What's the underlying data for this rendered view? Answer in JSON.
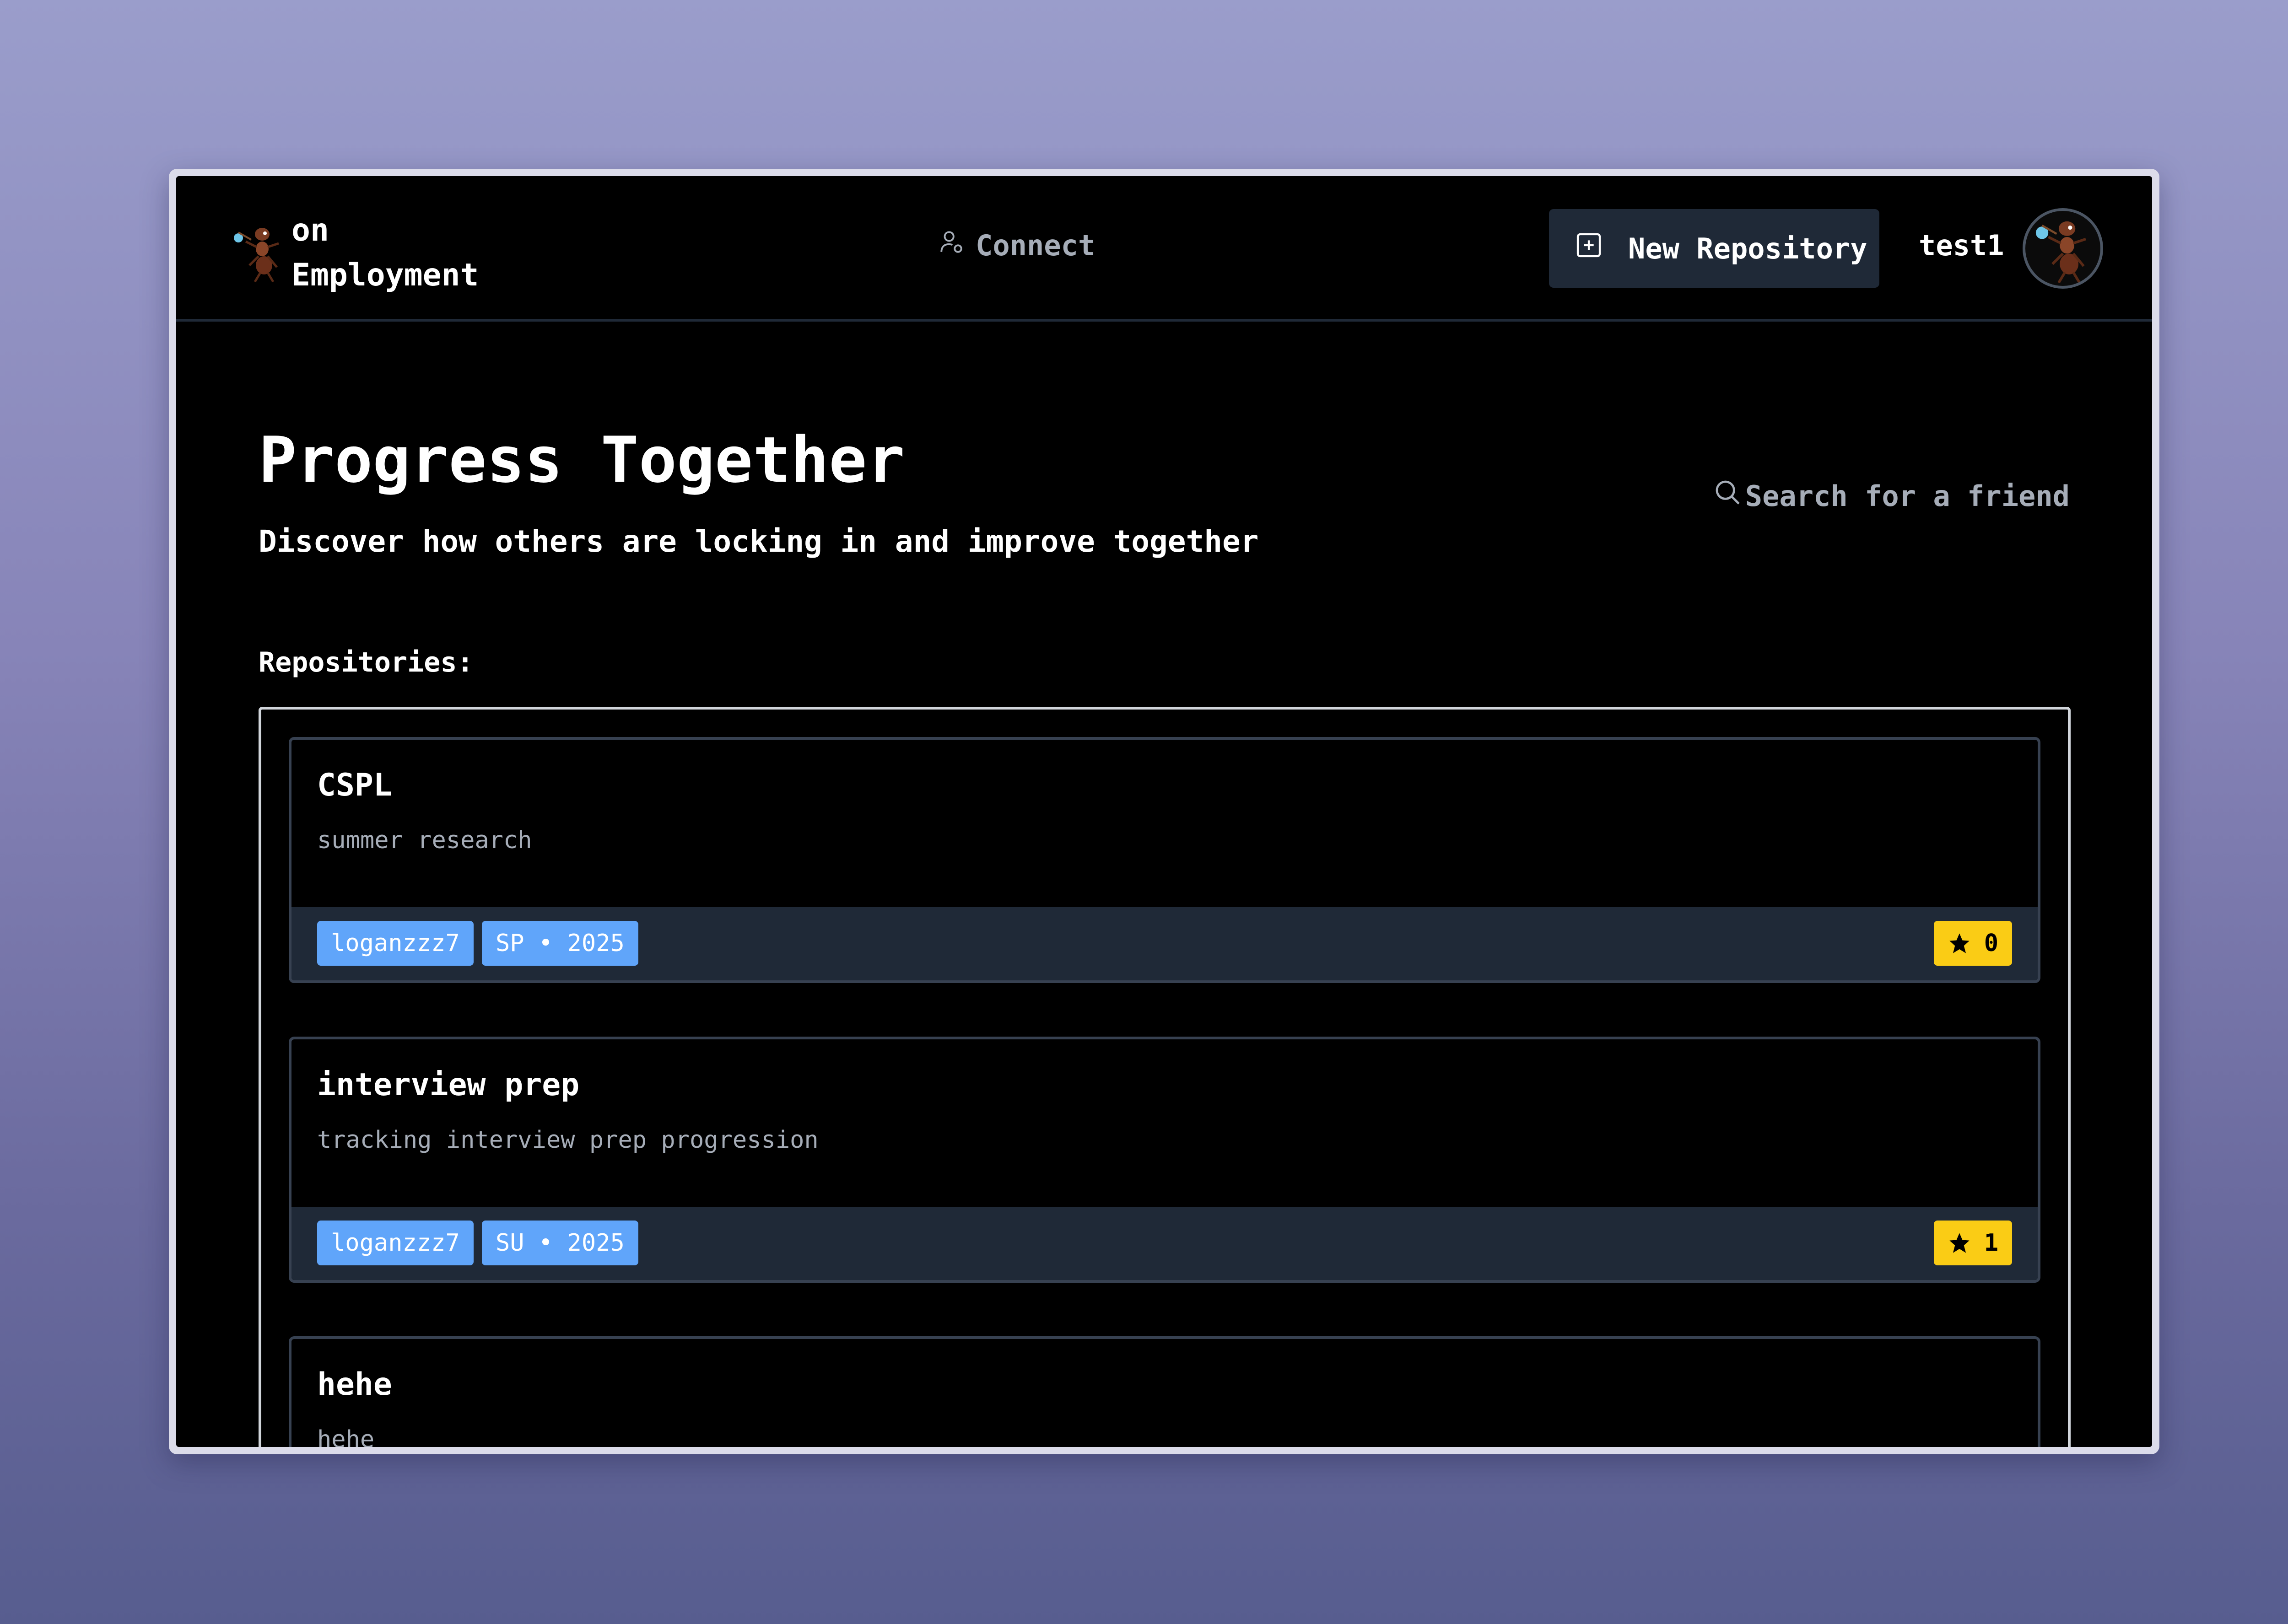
{
  "brand": {
    "line1": "on",
    "line2": "Employment",
    "logo_icon": "ant-mascot-icon"
  },
  "nav": {
    "connect_label": "Connect",
    "connect_icon": "user-connect-icon",
    "new_repo_label": "New Repository",
    "new_repo_icon": "plus-square-icon",
    "username": "test1",
    "avatar_icon": "ant-mascot-icon"
  },
  "hero": {
    "title": "Progress Together",
    "subtitle": "Discover how others are locking in and improve together"
  },
  "search": {
    "label": "Search for a friend",
    "icon": "search-icon"
  },
  "repositories": {
    "label": "Repositories:",
    "items": [
      {
        "name": "CSPL",
        "description": "summer research",
        "owner": "loganzzz7",
        "term": "SP • 2025",
        "stars": "0"
      },
      {
        "name": "interview prep",
        "description": "tracking interview prep progression",
        "owner": "loganzzz7",
        "term": "SU • 2025",
        "stars": "1"
      },
      {
        "name": "hehe",
        "description": "hehe"
      }
    ]
  },
  "colors": {
    "background": "#000000",
    "tag": "#60a5fa",
    "star_badge": "#facc15",
    "card_footer": "#1f2937"
  }
}
